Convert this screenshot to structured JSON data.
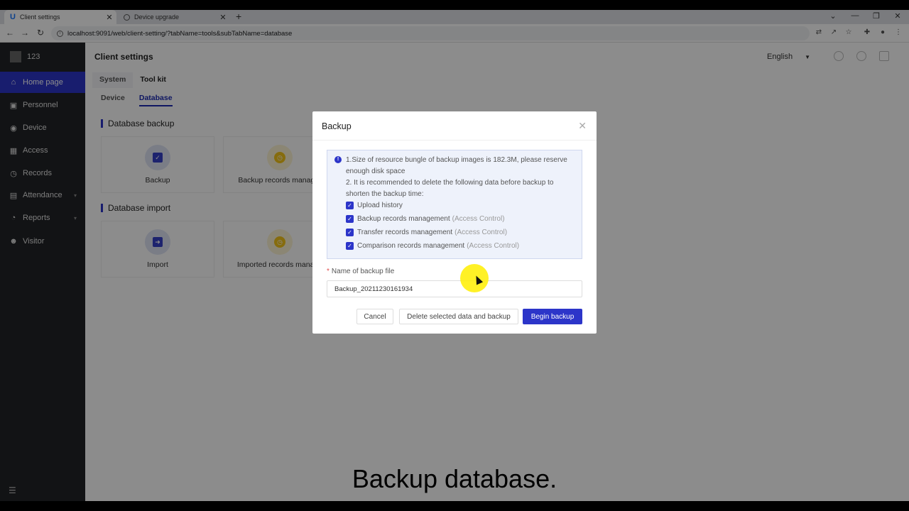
{
  "browser": {
    "tabs": [
      {
        "title": "Client settings",
        "logo": "U"
      },
      {
        "title": "Device upgrade"
      }
    ],
    "url": "localhost:9091/web/client-setting/?tabName=tools&subTabName=database"
  },
  "sidebar": {
    "user": "123",
    "items": [
      {
        "label": "Home page",
        "icon": "home-icon",
        "glyph": "⌂"
      },
      {
        "label": "Personnel",
        "icon": "id-card-icon",
        "glyph": "▣"
      },
      {
        "label": "Device",
        "icon": "device-icon",
        "glyph": "◉"
      },
      {
        "label": "Access",
        "icon": "grid-icon",
        "glyph": "▦"
      },
      {
        "label": "Records",
        "icon": "clock-icon",
        "glyph": "◷"
      },
      {
        "label": "Attendance",
        "icon": "calendar-icon",
        "glyph": "▤"
      },
      {
        "label": "Reports",
        "icon": "chart-pie-icon",
        "glyph": "◔"
      },
      {
        "label": "Visitor",
        "icon": "person-icon",
        "glyph": "☻"
      }
    ]
  },
  "header": {
    "title": "Client settings",
    "language": "English"
  },
  "tabs": [
    "System",
    "Tool kit"
  ],
  "subtabs": [
    "Device",
    "Database"
  ],
  "sections": [
    {
      "title": "Database backup",
      "cards": [
        "Backup",
        "Backup records manager"
      ]
    },
    {
      "title": "Database import",
      "cards": [
        "Import",
        "Imported records manage"
      ]
    }
  ],
  "modal": {
    "title": "Backup",
    "notice_line1": "1.Size of resource bungle of backup images is 182.3M, please reserve enough disk space",
    "notice_line2": "2. It is recommended to delete the following data before backup to shorten the backup time:",
    "checks": [
      {
        "label": "Upload history",
        "sub": ""
      },
      {
        "label": "Backup records management",
        "sub": "(Access Control)"
      },
      {
        "label": "Transfer records management",
        "sub": "(Access Control)"
      },
      {
        "label": "Comparison records management",
        "sub": "(Access Control)"
      }
    ],
    "field_label": "Name of backup file",
    "field_value": "Backup_20211230161934",
    "cancel": "Cancel",
    "delete_backup": "Delete selected data and backup",
    "begin": "Begin backup"
  },
  "caption": "Backup database."
}
